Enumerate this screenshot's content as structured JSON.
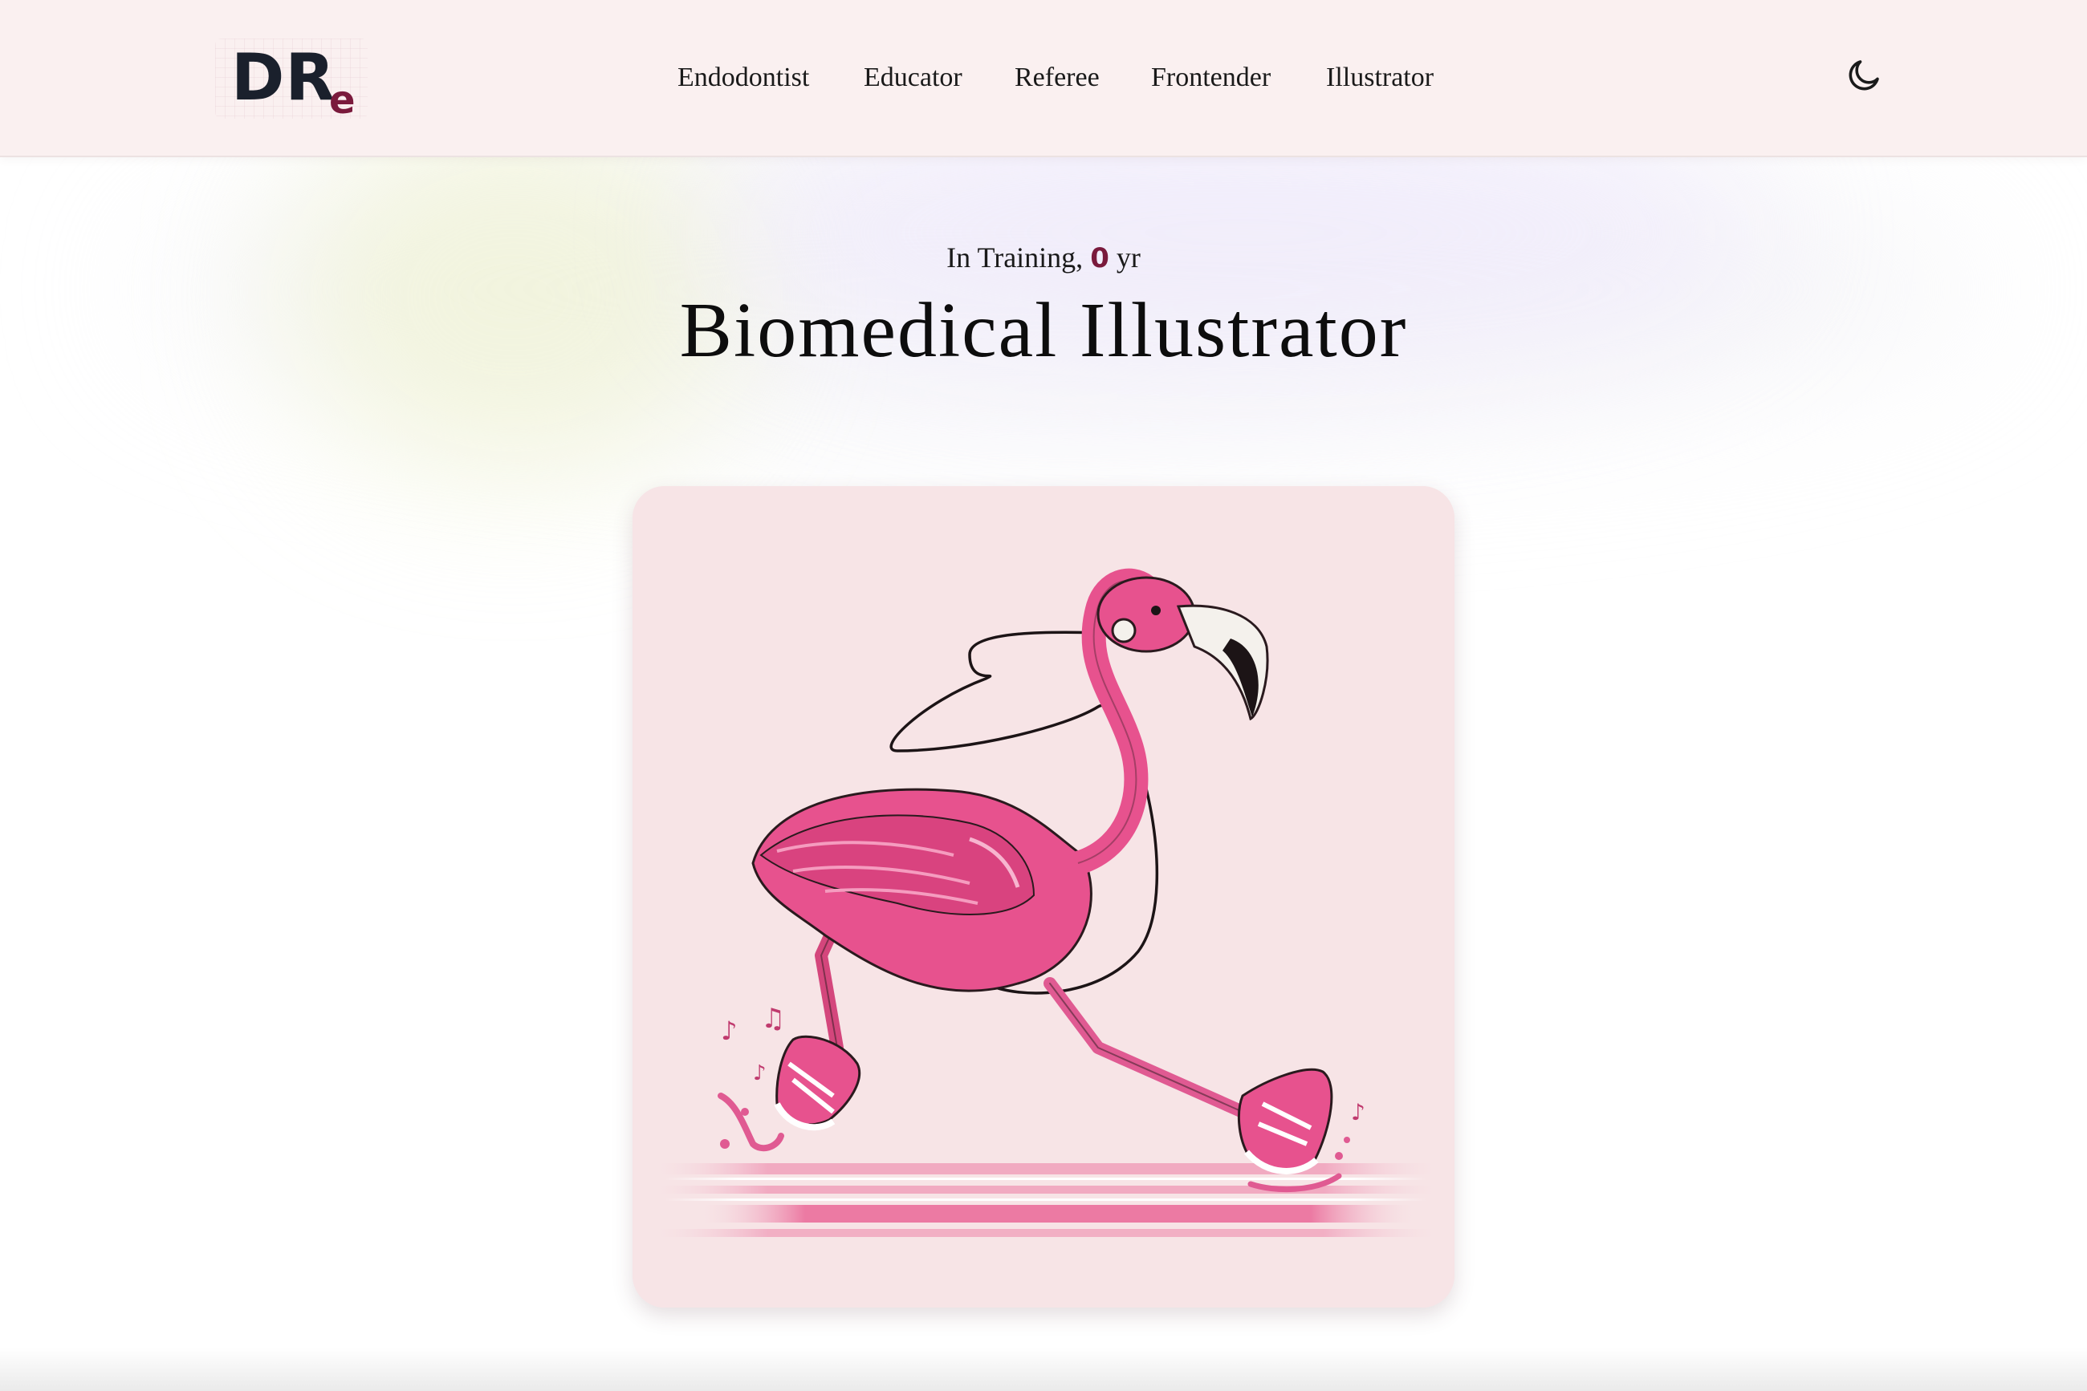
{
  "header": {
    "logo": {
      "main": "DR",
      "sub": "e"
    },
    "nav": [
      {
        "label": "Endodontist"
      },
      {
        "label": "Educator"
      },
      {
        "label": "Referee"
      },
      {
        "label": "Frontender"
      },
      {
        "label": "Illustrator"
      }
    ],
    "theme_toggle_icon": "moon-icon"
  },
  "hero": {
    "kicker_prefix": "In Training,",
    "years": "0",
    "kicker_suffix": "yr",
    "title": "Biomedical Illustrator"
  },
  "illustration": {
    "subject": "flamingo-running-with-earphones-illustration",
    "icons": [
      "music-note-icon",
      "music-note-icon",
      "music-note-icon"
    ]
  },
  "colors": {
    "header_bg": "#faf0f0",
    "accent": "#7a1a3c",
    "card_bg": "#f7e5e7",
    "flamingo_pink": "#e8558f",
    "text": "#141414"
  }
}
